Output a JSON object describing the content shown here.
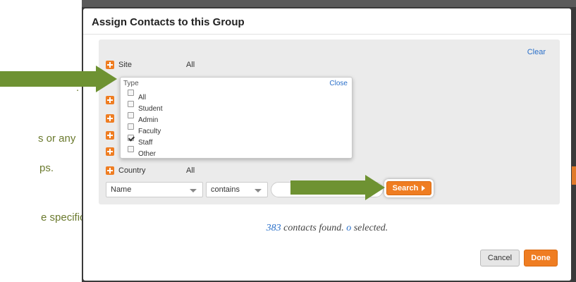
{
  "doc": {
    "line1": ".",
    "line2": "s or any",
    "line3": "ps.",
    "line4": "e specific"
  },
  "modal": {
    "title": "Assign Contacts to this Group"
  },
  "filters": {
    "clear_label": "Clear",
    "site": {
      "label": "Site",
      "value": "All"
    },
    "country": {
      "label": "Country",
      "value": "All"
    }
  },
  "type_popup": {
    "title": "Type",
    "close_label": "Close",
    "options": [
      {
        "label": "All",
        "checked": false
      },
      {
        "label": "Student",
        "checked": false
      },
      {
        "label": "Admin",
        "checked": false
      },
      {
        "label": "Faculty",
        "checked": false
      },
      {
        "label": "Staff",
        "checked": true
      },
      {
        "label": "Other",
        "checked": false
      }
    ]
  },
  "search": {
    "field_value": "Name",
    "operator_value": "contains",
    "button_label": "Search"
  },
  "results": {
    "count": "383",
    "found_text": " contacts found. ",
    "selected_count": "o",
    "selected_text": " selected."
  },
  "actions": {
    "cancel_label": "Cancel",
    "done_label": "Done"
  },
  "colors": {
    "accent": "#ef7d22",
    "link": "#2a6fc9",
    "arrow": "#6e9232"
  }
}
